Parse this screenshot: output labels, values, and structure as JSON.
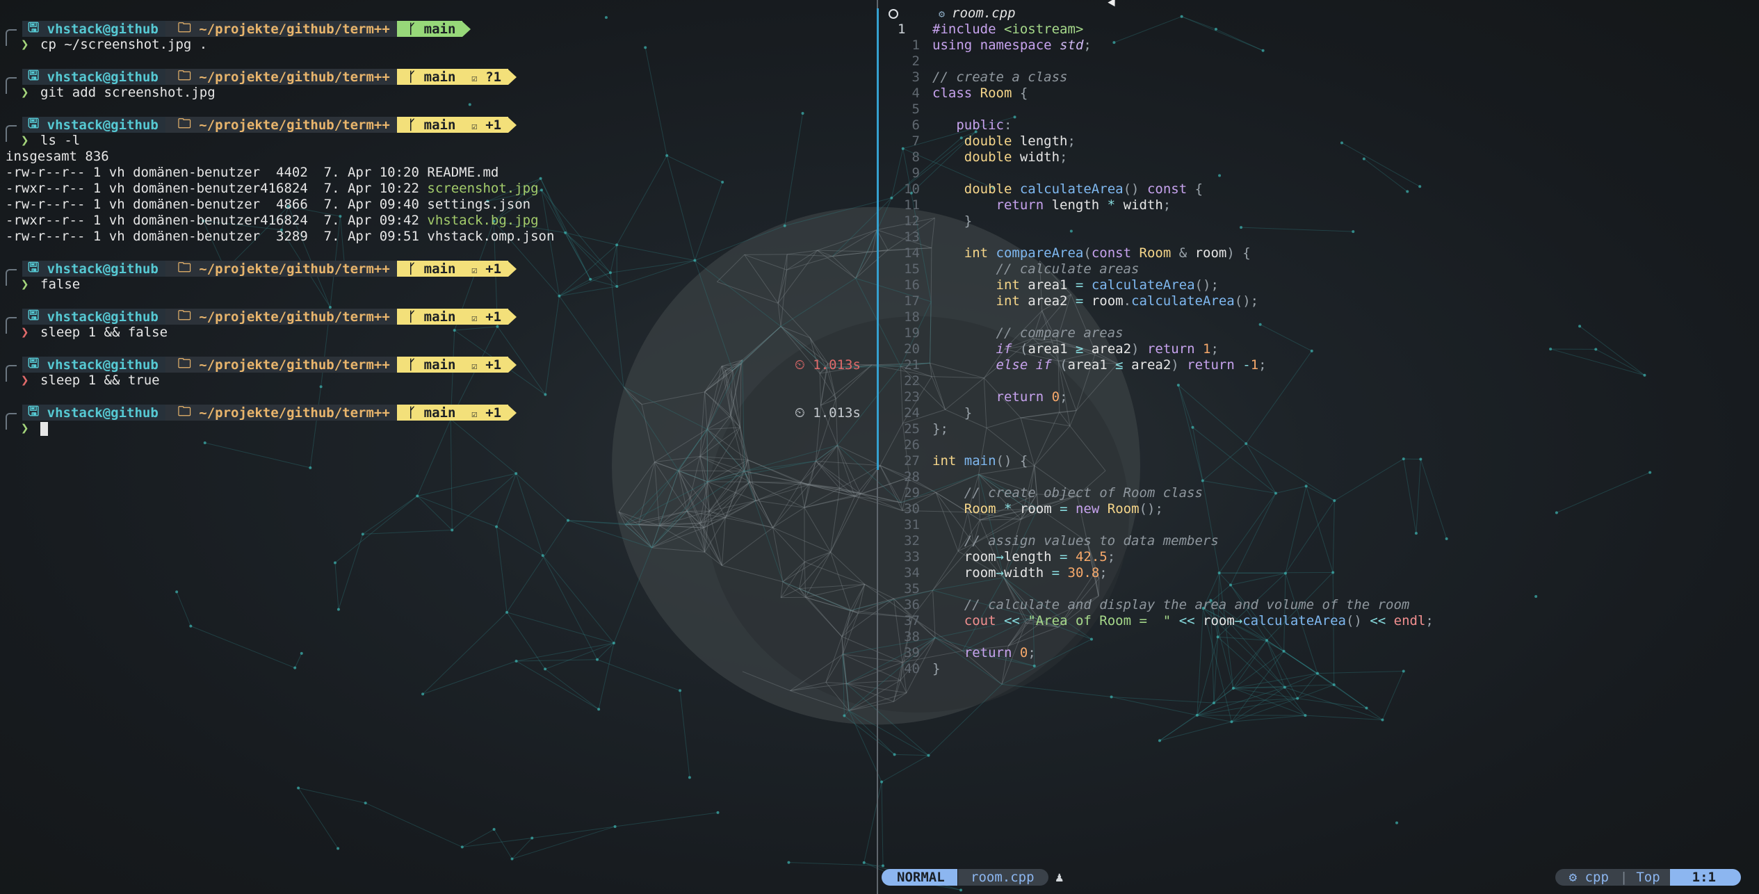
{
  "prompt": {
    "user_host": "vhstack@github",
    "path": "~/projekte/github/term++",
    "branch_icon": "branch-icon",
    "home_icon": "home-icon",
    "folder_icon": "folder-icon"
  },
  "terminal": {
    "blocks": [
      {
        "git": "main",
        "git_status": "",
        "git_color": "green",
        "command": "cp ~/screenshot.jpg .",
        "ok": true
      },
      {
        "git": "main",
        "git_status": "?1",
        "git_color": "yellow",
        "command": "git add screenshot.jpg",
        "ok": true
      },
      {
        "git": "main",
        "git_status": "+1",
        "git_color": "yellow",
        "command": "ls -l",
        "ok": true
      },
      {
        "git": "main",
        "git_status": "+1",
        "git_color": "yellow",
        "command": "false",
        "ok": true
      },
      {
        "git": "main",
        "git_status": "+1",
        "git_color": "yellow",
        "command": "sleep 1 && false",
        "ok": false
      },
      {
        "git": "main",
        "git_status": "+1",
        "git_color": "yellow",
        "command": "sleep 1 && true",
        "ok": false,
        "timing": "1.013s",
        "timing_error": true
      },
      {
        "git": "main",
        "git_status": "+1",
        "git_color": "yellow",
        "command": "",
        "ok": true,
        "timing": "1.013s",
        "timing_error": false
      }
    ],
    "ls_output": {
      "total": "insgesamt 836",
      "rows": [
        {
          "perm": "-rw-r--r--",
          "links": "1",
          "owner": "vh",
          "group": "domänen-benutzer",
          "size": "  4402",
          "date": "7. Apr 10:20",
          "name": "README.md",
          "highlight": false
        },
        {
          "perm": "-rwxr--r--",
          "links": "1",
          "owner": "vh",
          "group": "domänen-benutzer",
          "size": "416824",
          "date": "7. Apr 10:22",
          "name": "screenshot.jpg",
          "highlight": true
        },
        {
          "perm": "-rw-r--r--",
          "links": "1",
          "owner": "vh",
          "group": "domänen-benutzer",
          "size": "  4866",
          "date": "7. Apr 09:40",
          "name": "settings.json",
          "highlight": false
        },
        {
          "perm": "-rwxr--r--",
          "links": "1",
          "owner": "vh",
          "group": "domänen-benutzer",
          "size": "416824",
          "date": "7. Apr 09:42",
          "name": "vhstack.bg.jpg",
          "highlight": true
        },
        {
          "perm": "-rw-r--r--",
          "links": "1",
          "owner": "vh",
          "group": "domänen-benutzer",
          "size": "  3289",
          "date": "7. Apr 09:51",
          "name": "vhstack.omp.json",
          "highlight": false
        }
      ]
    }
  },
  "editor": {
    "tab_title": "room.cpp",
    "current_line": "1",
    "line_numbers": [
      "1",
      "1",
      "2",
      "3",
      "4",
      "5",
      "6",
      "7",
      "8",
      "9",
      "10",
      "11",
      "12",
      "13",
      "14",
      "15",
      "16",
      "17",
      "18",
      "19",
      "20",
      "21",
      "22",
      "23",
      "24",
      "25",
      "26",
      "27",
      "28",
      "29",
      "30",
      "31",
      "32",
      "33",
      "34",
      "35",
      "36",
      "37",
      "38",
      "39",
      "40"
    ],
    "code": [
      "#include <iostream>",
      "using namespace std;",
      "",
      "// create a class",
      "class Room {",
      "",
      "   public:",
      "    double length;",
      "    double width;",
      "",
      "    double calculateArea() const {",
      "        return length * width;",
      "    }",
      "",
      "    int compareArea(const Room & room) {",
      "        // calculate areas",
      "        int area1 = calculateArea();",
      "        int area2 = room.calculateArea();",
      "",
      "        // compare areas",
      "        if (area1 ≥ area2) return 1;",
      "        else if (area1 ≤ area2) return -1;",
      "",
      "        return 0;",
      "    }",
      "};",
      "",
      "int main() {",
      "",
      "    // create object of Room class",
      "    Room * room = new Room();",
      "",
      "    // assign values to data members",
      "    room→length = 42.5;",
      "    room→width = 30.8;",
      "",
      "    // calculate and display the area and volume of the room",
      "    cout << \"Area of Room =  \" << room→calculateArea() << endl;",
      "",
      "    return 0;",
      "}"
    ]
  },
  "statusline": {
    "mode": "NORMAL",
    "file": "room.cpp",
    "filetype": "cpp",
    "position": "Top",
    "line_col": "1:1",
    "separator": "|"
  },
  "colors": {
    "accent_blue": "#8cb6f0",
    "prompt_green": "#97d879",
    "prompt_yellow": "#f3e07a",
    "error_red": "#e06a6a"
  }
}
